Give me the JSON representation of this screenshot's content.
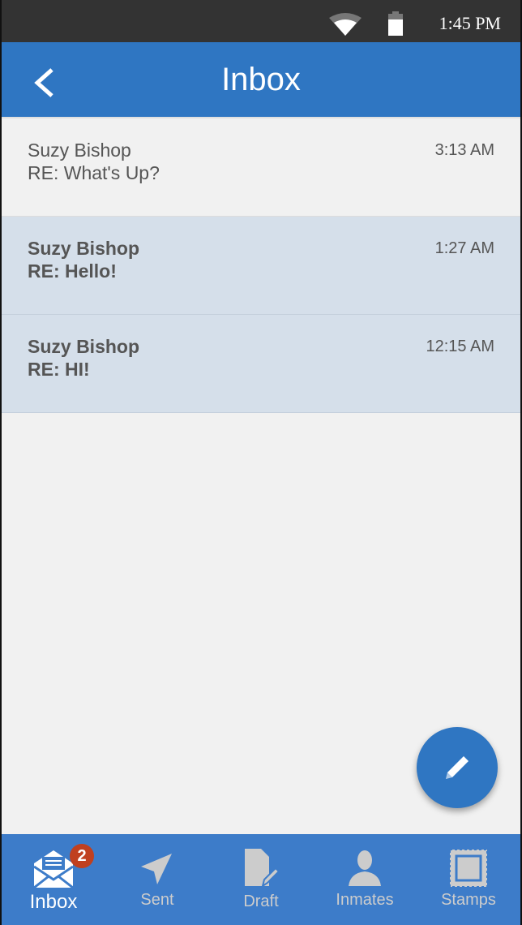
{
  "status_bar": {
    "time": "1:45 PM"
  },
  "header": {
    "title": "Inbox"
  },
  "messages": [
    {
      "from": "Suzy Bishop",
      "subject": "RE:  What's Up?",
      "time": "3:13 AM",
      "unread": false
    },
    {
      "from": "Suzy Bishop",
      "subject": "RE: Hello!",
      "time": "1:27 AM",
      "unread": true
    },
    {
      "from": "Suzy Bishop",
      "subject": "RE: HI!",
      "time": "12:15 AM",
      "unread": true
    }
  ],
  "nav": {
    "inbox": "Inbox",
    "inbox_badge": "2",
    "sent": "Sent",
    "draft": "Draft",
    "inmates": "Inmates",
    "stamps": "Stamps"
  },
  "colors": {
    "primary": "#2f76c2",
    "nav": "#3d7cc9",
    "badge": "#c0401f",
    "unread_bg": "#d5dfea"
  }
}
